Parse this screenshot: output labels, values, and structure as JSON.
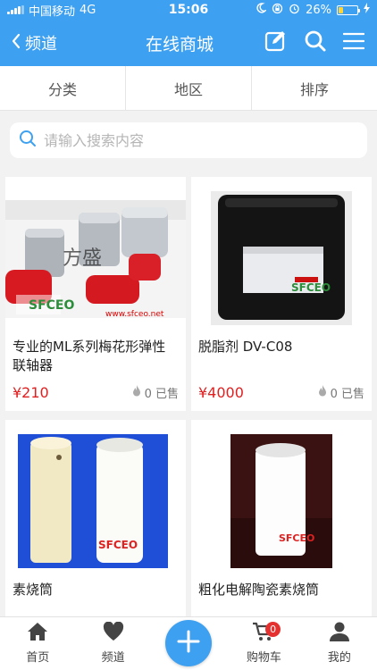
{
  "status_bar": {
    "carrier": "中国移动",
    "network": "4G",
    "time": "15:06",
    "battery": "26%",
    "battery_level": 0.26
  },
  "nav": {
    "back_label": "频道",
    "title": "在线商城",
    "icons": [
      "edit-icon",
      "search-icon",
      "menu-icon"
    ]
  },
  "filters": [
    "分类",
    "地区",
    "排序"
  ],
  "search": {
    "placeholder": "请输入搜索内容"
  },
  "products": [
    {
      "title": "专业的ML系列梅花形弹性联轴器",
      "price": "¥210",
      "sold": "0 已售",
      "image_text": "方盛",
      "watermark": "www.sfceo.net"
    },
    {
      "title": "脱脂剂 DV-C08",
      "price": "¥4000",
      "sold": "0 已售",
      "image_text": "",
      "watermark": ""
    },
    {
      "title": "素烧筒",
      "price": "",
      "sold": "",
      "image_text": "",
      "watermark": ""
    },
    {
      "title": "粗化电解陶瓷素烧筒",
      "price": "",
      "sold": "",
      "image_text": "",
      "watermark": ""
    }
  ],
  "tabbar": {
    "items": [
      {
        "label": "首页",
        "icon": "home-icon"
      },
      {
        "label": "频道",
        "icon": "heart-icon"
      },
      {
        "label": "",
        "icon": "plus-icon"
      },
      {
        "label": "购物车",
        "icon": "cart-icon",
        "badge": "0"
      },
      {
        "label": "我的",
        "icon": "user-icon"
      }
    ]
  },
  "colors": {
    "brand": "#3ea0f0",
    "price": "#e02020",
    "badge": "#e53030"
  }
}
